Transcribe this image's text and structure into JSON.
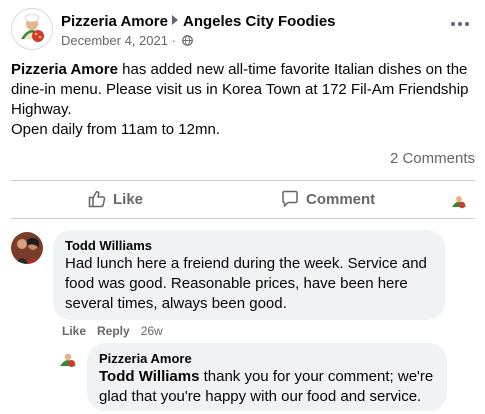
{
  "post": {
    "page_name": "Pizzeria Amore",
    "group_name": "Angeles City Foodies",
    "date": "December 4, 2021",
    "body_name": "Pizzeria Amore",
    "body_text": " has added new all-time favorite Italian dishes on the dine-in menu. Please visit us in Korea Town at 172 Fil-Am Friendship Highway.",
    "hours": "Open daily from 11am to 12mn.",
    "comments_count": "2 Comments"
  },
  "actions": {
    "like": "Like",
    "comment": "Comment"
  },
  "comments": [
    {
      "author": "Todd Williams",
      "text": "Had lunch here a freiend during the week. Service and food was good. Reasonable prices, have been here several times, always been good.",
      "like": "Like",
      "reply": "Reply",
      "time": "26w"
    }
  ],
  "reply": {
    "author": "Pizzeria Amore",
    "mention": "Todd Williams",
    "text": " thank you for your comment; we're glad that you're happy with our food and service."
  },
  "colors": {
    "text_primary": "#050505",
    "text_secondary": "#65676b",
    "bubble_bg": "#f0f2f5",
    "divider": "#ced0d4"
  },
  "icons": {
    "more": "more-horizontal-icon",
    "privacy": "globe-icon",
    "like": "thumbs-up-icon",
    "comment": "comment-bubble-icon",
    "group_separator": "caret-right-icon"
  }
}
